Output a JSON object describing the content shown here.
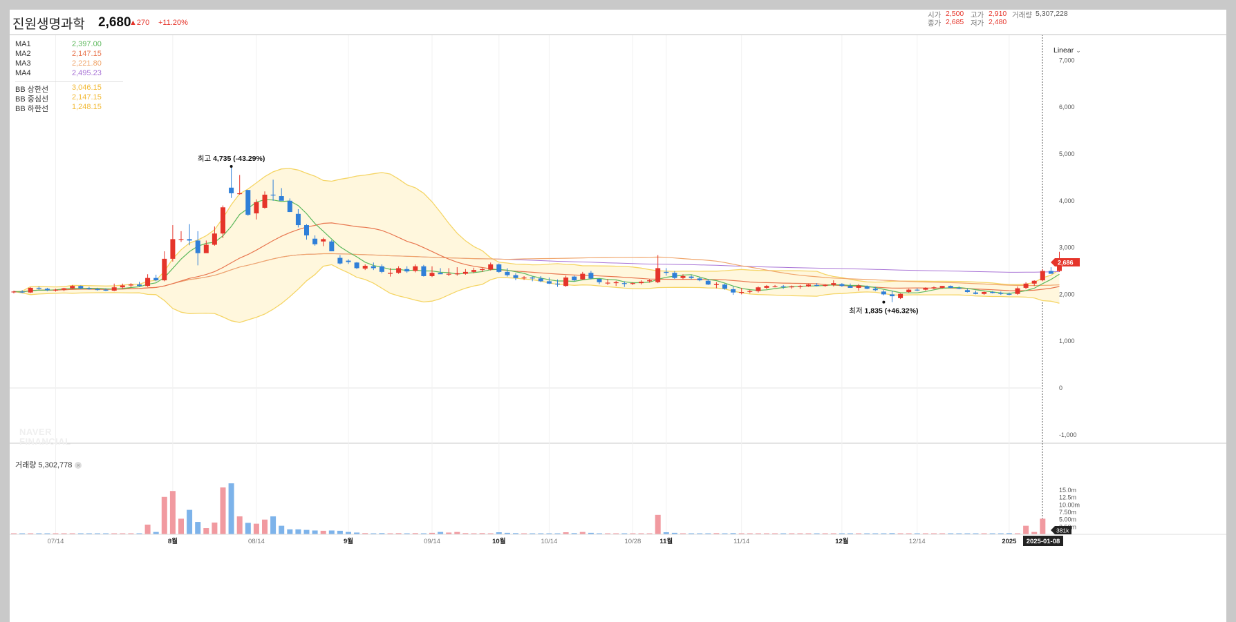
{
  "stock": {
    "name": "진원생명과학",
    "price": "2,680",
    "change": "▲270",
    "change_rate": "+11.20%"
  },
  "ohlc_summary": {
    "open_label": "시가",
    "open_value": "2,500",
    "high_label": "고가",
    "high_value": "2,910",
    "volume_label": "거래량",
    "volume_value": "5,307,228",
    "close_label": "종가",
    "close_value": "2,685",
    "low_label": "저가",
    "low_value": "2,480"
  },
  "legend": {
    "ma": [
      {
        "name": "MA1",
        "value": "2,397.00",
        "color": "#5cb85c"
      },
      {
        "name": "MA2",
        "value": "2,147.15",
        "color": "#e8754e"
      },
      {
        "name": "MA3",
        "value": "2,221.80",
        "color": "#f0a56b"
      },
      {
        "name": "MA4",
        "value": "2,495.23",
        "color": "#a873d6"
      }
    ],
    "bb": [
      {
        "name": "BB 상한선",
        "value": "3,046.15",
        "color": "#f2b934"
      },
      {
        "name": "BB 중심선",
        "value": "2,147.15",
        "color": "#f2b934"
      },
      {
        "name": "BB 하한선",
        "value": "1,248.15",
        "color": "#f2b934"
      }
    ]
  },
  "volume_panel": {
    "label": "거래량 5,302,778",
    "close_symbol": "×"
  },
  "scale_button": {
    "label": "Linear",
    "icon": "chevron-down-icon"
  },
  "watermark": {
    "line1": "NAVER",
    "line2": "FINANCIAL"
  },
  "colors": {
    "up": "#e5342a",
    "down": "#2f7fd8",
    "vol_up": "#f19aa0",
    "vol_down": "#7db3ea",
    "bb_fill": "#fff7dd",
    "bb_line": "#f5d565"
  },
  "chart_data": {
    "type": "candlestick",
    "price_axis": {
      "min": -1000,
      "max": 7000,
      "ticks": [
        "-1,000",
        "0",
        "1,000",
        "2,000",
        "3,000",
        "4,000",
        "5,000",
        "6,000",
        "7,000"
      ]
    },
    "volume_axis": {
      "min": 0,
      "max": 15000000,
      "ticks": [
        "2.50m",
        "5.00m",
        "7.50m",
        "10.00m",
        "12.5m",
        "15.0m"
      ]
    },
    "x_labels": [
      {
        "i": 5,
        "text": "07/14",
        "bold": false
      },
      {
        "i": 19,
        "text": "8월",
        "bold": true
      },
      {
        "i": 29,
        "text": "08/14",
        "bold": false
      },
      {
        "i": 40,
        "text": "9월",
        "bold": true
      },
      {
        "i": 50,
        "text": "09/14",
        "bold": false
      },
      {
        "i": 58,
        "text": "10월",
        "bold": true
      },
      {
        "i": 64,
        "text": "10/14",
        "bold": false
      },
      {
        "i": 74,
        "text": "10/28",
        "bold": false
      },
      {
        "i": 78,
        "text": "11월",
        "bold": true
      },
      {
        "i": 87,
        "text": "11/14",
        "bold": false
      },
      {
        "i": 99,
        "text": "12월",
        "bold": true
      },
      {
        "i": 108,
        "text": "12/14",
        "bold": false
      },
      {
        "i": 119,
        "text": "2025",
        "bold": true
      }
    ],
    "current_price_tag": "2,686",
    "current_volume_tag": "381k",
    "current_date_tag": "2025-01-08",
    "annotations": [
      {
        "label": "최고",
        "value": "4,735 (-43.29%)",
        "i": 26,
        "price": 4735,
        "pos": "above"
      },
      {
        "label": "최저",
        "value": "1,835 (+46.32%)",
        "i": 104,
        "price": 1835,
        "pos": "below"
      }
    ],
    "candles": [
      [
        2050,
        2080,
        2020,
        2060
      ],
      [
        2060,
        2090,
        2030,
        2040
      ],
      [
        2040,
        2150,
        2030,
        2140
      ],
      [
        2140,
        2170,
        2100,
        2120
      ],
      [
        2120,
        2140,
        2070,
        2090
      ],
      [
        2090,
        2120,
        2060,
        2100
      ],
      [
        2100,
        2140,
        2070,
        2130
      ],
      [
        2130,
        2200,
        2110,
        2180
      ],
      [
        2180,
        2190,
        2110,
        2130
      ],
      [
        2130,
        2160,
        2100,
        2110
      ],
      [
        2110,
        2140,
        2080,
        2100
      ],
      [
        2100,
        2130,
        2070,
        2080
      ],
      [
        2080,
        2230,
        2070,
        2150
      ],
      [
        2150,
        2230,
        2120,
        2190
      ],
      [
        2190,
        2240,
        2150,
        2210
      ],
      [
        2210,
        2270,
        2170,
        2180
      ],
      [
        2180,
        2430,
        2160,
        2350
      ],
      [
        2350,
        2420,
        2280,
        2300
      ],
      [
        2300,
        2920,
        2280,
        2760
      ],
      [
        2760,
        3480,
        2700,
        3180
      ],
      [
        3180,
        3350,
        3120,
        3180
      ],
      [
        3180,
        3500,
        3050,
        3150
      ],
      [
        3150,
        3350,
        2620,
        2880
      ],
      [
        2880,
        3150,
        2900,
        3060
      ],
      [
        3060,
        3450,
        3040,
        3300
      ],
      [
        3300,
        3900,
        3200,
        3860
      ],
      [
        4280,
        4735,
        4060,
        4160
      ],
      [
        4160,
        4550,
        4130,
        4160
      ],
      [
        4230,
        4230,
        3680,
        3700
      ],
      [
        3730,
        4030,
        3600,
        3970
      ],
      [
        3850,
        4200,
        3830,
        4130
      ],
      [
        4130,
        4450,
        4000,
        4120
      ],
      [
        4100,
        4270,
        4050,
        4000
      ],
      [
        4000,
        4050,
        3760,
        3760
      ],
      [
        3720,
        3820,
        3430,
        3480
      ],
      [
        3480,
        3500,
        3170,
        3260
      ],
      [
        3190,
        3260,
        3040,
        3070
      ],
      [
        3130,
        3210,
        3030,
        3180
      ],
      [
        3130,
        3160,
        2920,
        2920
      ],
      [
        2780,
        2840,
        2640,
        2660
      ],
      [
        2720,
        2750,
        2650,
        2690
      ],
      [
        2680,
        2690,
        2540,
        2560
      ],
      [
        2550,
        2640,
        2520,
        2610
      ],
      [
        2600,
        2680,
        2520,
        2560
      ],
      [
        2600,
        2640,
        2450,
        2480
      ],
      [
        2440,
        2560,
        2380,
        2460
      ],
      [
        2460,
        2600,
        2440,
        2560
      ],
      [
        2540,
        2600,
        2460,
        2490
      ],
      [
        2500,
        2640,
        2470,
        2600
      ],
      [
        2600,
        2630,
        2380,
        2390
      ],
      [
        2390,
        2600,
        2370,
        2460
      ],
      [
        2460,
        2560,
        2440,
        2430
      ],
      [
        2430,
        2560,
        2390,
        2440
      ],
      [
        2430,
        2580,
        2400,
        2450
      ],
      [
        2440,
        2540,
        2420,
        2480
      ],
      [
        2480,
        2570,
        2450,
        2520
      ],
      [
        2520,
        2560,
        2480,
        2540
      ],
      [
        2530,
        2680,
        2510,
        2640
      ],
      [
        2640,
        2660,
        2460,
        2480
      ],
      [
        2480,
        2560,
        2380,
        2410
      ],
      [
        2410,
        2450,
        2300,
        2350
      ],
      [
        2350,
        2390,
        2310,
        2360
      ],
      [
        2360,
        2380,
        2280,
        2340
      ],
      [
        2340,
        2390,
        2260,
        2280
      ],
      [
        2280,
        2360,
        2220,
        2230
      ],
      [
        2230,
        2320,
        2160,
        2220
      ],
      [
        2180,
        2400,
        2160,
        2360
      ],
      [
        2380,
        2400,
        2280,
        2300
      ],
      [
        2320,
        2480,
        2310,
        2440
      ],
      [
        2460,
        2500,
        2320,
        2340
      ],
      [
        2330,
        2340,
        2220,
        2260
      ],
      [
        2250,
        2330,
        2200,
        2250
      ],
      [
        2240,
        2290,
        2180,
        2260
      ],
      [
        2240,
        2280,
        2160,
        2230
      ],
      [
        2230,
        2260,
        2200,
        2240
      ],
      [
        2240,
        2300,
        2210,
        2270
      ],
      [
        2280,
        2320,
        2250,
        2300
      ],
      [
        2260,
        2840,
        2240,
        2560
      ],
      [
        2480,
        2560,
        2400,
        2460
      ],
      [
        2460,
        2500,
        2330,
        2350
      ],
      [
        2350,
        2430,
        2320,
        2390
      ],
      [
        2380,
        2410,
        2320,
        2350
      ],
      [
        2340,
        2380,
        2280,
        2300
      ],
      [
        2290,
        2330,
        2200,
        2210
      ],
      [
        2200,
        2260,
        2130,
        2220
      ],
      [
        2210,
        2230,
        2100,
        2120
      ],
      [
        2110,
        2170,
        1990,
        2040
      ],
      [
        2050,
        2140,
        2000,
        2050
      ],
      [
        2060,
        2100,
        2020,
        2070
      ],
      [
        2070,
        2170,
        2040,
        2150
      ],
      [
        2140,
        2200,
        2110,
        2180
      ],
      [
        2160,
        2200,
        2150,
        2170
      ],
      [
        2170,
        2200,
        2120,
        2160
      ],
      [
        2150,
        2190,
        2120,
        2170
      ],
      [
        2160,
        2200,
        2120,
        2180
      ],
      [
        2170,
        2220,
        2160,
        2210
      ],
      [
        2200,
        2240,
        2170,
        2190
      ],
      [
        2180,
        2220,
        2160,
        2200
      ],
      [
        2200,
        2300,
        2170,
        2240
      ],
      [
        2220,
        2240,
        2160,
        2180
      ],
      [
        2180,
        2230,
        2140,
        2140
      ],
      [
        2140,
        2220,
        2080,
        2190
      ],
      [
        2170,
        2190,
        2110,
        2120
      ],
      [
        2120,
        2160,
        2070,
        2090
      ],
      [
        2060,
        2090,
        1980,
        2000
      ],
      [
        2000,
        2080,
        1835,
        1960
      ],
      [
        1920,
        2020,
        1900,
        2010
      ],
      [
        2050,
        2120,
        2030,
        2100
      ],
      [
        2100,
        2130,
        2070,
        2090
      ],
      [
        2100,
        2150,
        2080,
        2140
      ],
      [
        2130,
        2170,
        2110,
        2150
      ],
      [
        2140,
        2180,
        2120,
        2180
      ],
      [
        2180,
        2190,
        2130,
        2140
      ],
      [
        2140,
        2170,
        2110,
        2120
      ],
      [
        2090,
        2120,
        2040,
        2050
      ],
      [
        2040,
        2080,
        2000,
        2010
      ],
      [
        2010,
        2060,
        1990,
        2050
      ],
      [
        2050,
        2070,
        2020,
        2030
      ],
      [
        2030,
        2060,
        1990,
        2010
      ],
      [
        2010,
        2040,
        1980,
        2000
      ],
      [
        2010,
        2170,
        1990,
        2130
      ],
      [
        2140,
        2260,
        2110,
        2230
      ],
      [
        2230,
        2300,
        2180,
        2290
      ],
      [
        2300,
        2540,
        2280,
        2500
      ],
      [
        2500,
        2580,
        2440,
        2440
      ],
      [
        2500,
        2910,
        2480,
        2685
      ]
    ],
    "volume_m": [
      0.05,
      0.3,
      0.1,
      0.05,
      0.05,
      0.05,
      0.1,
      0.05,
      0.05,
      0.05,
      0.05,
      0.3,
      0.2,
      0.2,
      0.2,
      0.1,
      3.3,
      0.8,
      12.7,
      14.7,
      5.3,
      8.3,
      4.2,
      2.1,
      4.0,
      15.9,
      17.3,
      6.1,
      3.9,
      3.6,
      5.0,
      6.1,
      2.9,
      1.7,
      1.7,
      1.5,
      1.3,
      1.2,
      1.3,
      1.2,
      0.8,
      0.6,
      0.4,
      0.3,
      0.4,
      0.3,
      0.4,
      0.2,
      0.4,
      0.3,
      0.5,
      0.8,
      0.6,
      0.8,
      0.4,
      0.3,
      0.4,
      0.3,
      0.7,
      0.5,
      0.4,
      0.3,
      0.2,
      0.3,
      0.2,
      0.2,
      0.7,
      0.4,
      0.8,
      0.5,
      0.3,
      0.2,
      0.2,
      0.2,
      0.2,
      0.2,
      0.3,
      6.6,
      0.7,
      0.5,
      0.3,
      0.3,
      0.3,
      0.2,
      0.4,
      0.3,
      0.4,
      0.3,
      0.2,
      0.3,
      0.3,
      0.2,
      0.2,
      0.2,
      0.3,
      0.3,
      0.3,
      0.3,
      0.3,
      0.2,
      0.3,
      0.2,
      0.3,
      0.3,
      0.2,
      0.4,
      0.3,
      0.2,
      0.3,
      0.2,
      0.2,
      0.2,
      0.2,
      0.2,
      0.2,
      0.2,
      0.2,
      0.2,
      0.3,
      0.4,
      0.2,
      2.9,
      0.8,
      5.3
    ]
  }
}
